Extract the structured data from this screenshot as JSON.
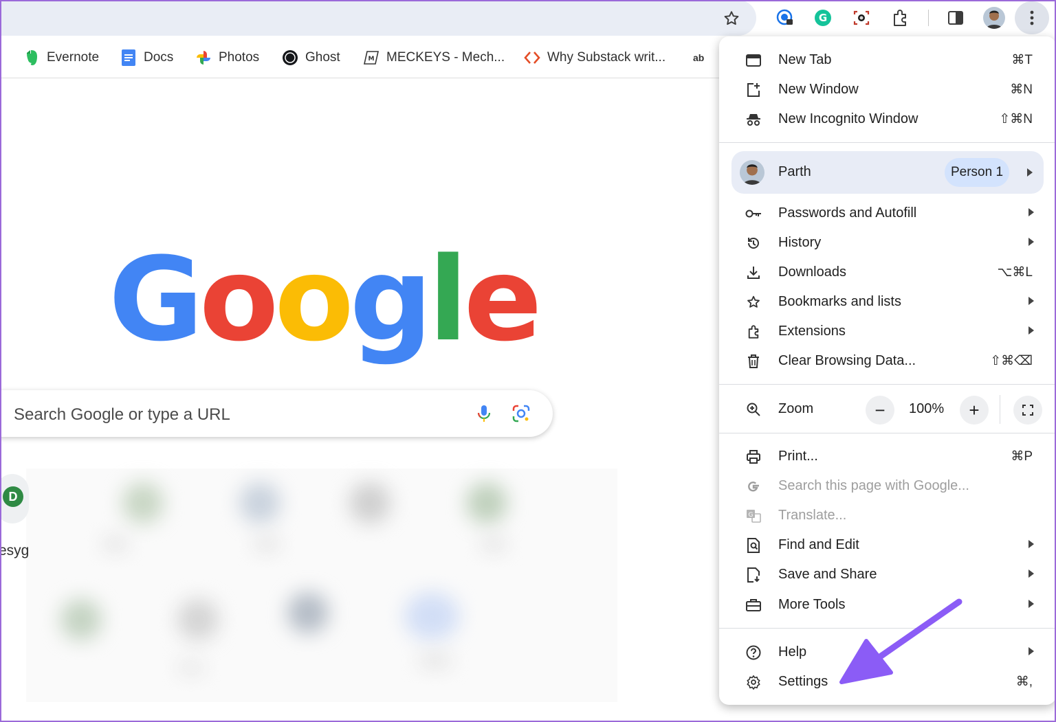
{
  "bookmarks": [
    {
      "label": "Evernote",
      "icon": "evernote-icon"
    },
    {
      "label": "Docs",
      "icon": "docs-icon"
    },
    {
      "label": "Photos",
      "icon": "photos-icon"
    },
    {
      "label": "Ghost",
      "icon": "ghost-icon"
    },
    {
      "label": "MECKEYS - Mech...",
      "icon": "meckeys-icon"
    },
    {
      "label": "Why Substack writ...",
      "icon": "substack-icon"
    },
    {
      "label": "ab",
      "icon": "ab-icon"
    }
  ],
  "google_logo": {
    "letters": [
      "G",
      "o",
      "o",
      "g",
      "l",
      "e"
    ],
    "colors": [
      "#4285f4",
      "#ea4335",
      "#fbbc05",
      "#4285f4",
      "#34a853",
      "#ea4335"
    ]
  },
  "search": {
    "placeholder": "Search Google or type a URL"
  },
  "shortcuts": {
    "first_letter": "D",
    "first_label": "esyg"
  },
  "menu": {
    "new_tab": {
      "label": "New Tab",
      "shortcut": "⌘T"
    },
    "new_window": {
      "label": "New Window",
      "shortcut": "⌘N"
    },
    "new_incognito": {
      "label": "New Incognito Window",
      "shortcut": "⇧⌘N"
    },
    "profile": {
      "name": "Parth",
      "chip": "Person 1"
    },
    "passwords": {
      "label": "Passwords and Autofill"
    },
    "history": {
      "label": "History"
    },
    "downloads": {
      "label": "Downloads",
      "shortcut": "⌥⌘L"
    },
    "bookmarks": {
      "label": "Bookmarks and lists"
    },
    "extensions": {
      "label": "Extensions"
    },
    "clear_data": {
      "label": "Clear Browsing Data...",
      "shortcut": "⇧⌘⌫"
    },
    "zoom": {
      "label": "Zoom",
      "value": "100%",
      "minus": "−",
      "plus": "+"
    },
    "print": {
      "label": "Print...",
      "shortcut": "⌘P"
    },
    "search_page": {
      "label": "Search this page with Google..."
    },
    "translate": {
      "label": "Translate..."
    },
    "find_edit": {
      "label": "Find and Edit"
    },
    "save_share": {
      "label": "Save and Share"
    },
    "more_tools": {
      "label": "More Tools"
    },
    "help": {
      "label": "Help"
    },
    "settings": {
      "label": "Settings",
      "shortcut": "⌘,"
    }
  },
  "colors": {
    "accent_arrow": "#8b5cf6",
    "menu_highlight": "#e8ecf6",
    "chip": "#d3e3fd"
  }
}
